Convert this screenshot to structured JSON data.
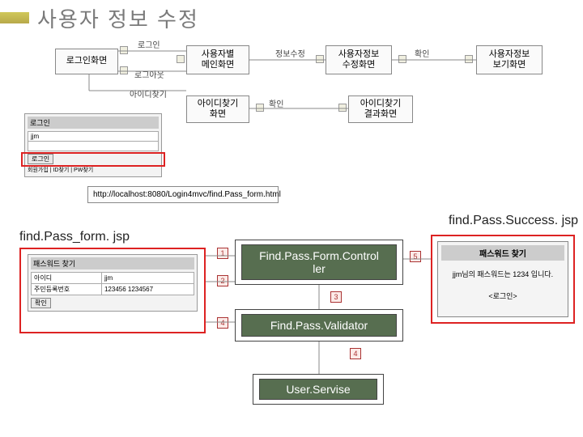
{
  "title": "사용자 정보 수정",
  "flow": {
    "login_screen": "로그인화면",
    "user_main": "사용자별\n메인화면",
    "user_edit": "사용자정보\n수정화면",
    "user_view": "사용자정보\n보기화면",
    "findid_screen": "아이디찾기\n화면",
    "findid_result": "아이디찾기\n결과화면"
  },
  "edges": {
    "login": "로그인",
    "logout": "로그아웃",
    "findid": "아이디찾기",
    "edit_info": "정보수정",
    "confirm1": "확인",
    "confirm2": "확인"
  },
  "url": "http://localhost:8080/Login4mvc/find.Pass_form.html",
  "jsp_form": "find.Pass_form. jsp",
  "jsp_success": "find.Pass.Success. jsp",
  "login_mock": {
    "header": "로그인",
    "id_val": "jjm",
    "btn_login": "로그인",
    "line": "회원가입  |  ID찾기  |  PW찾기"
  },
  "form_mock": {
    "header": "패스워드 찾기",
    "row1_label": "아이디",
    "row1_val": "jjm",
    "row2_label": "주민등록번호",
    "row2_val": "123456 1234567",
    "btn": "확인"
  },
  "controllers": {
    "form_ctrl": "Find.Pass.Form.Control\nler",
    "validator": "Find.Pass.Validator",
    "service": "User.Servise"
  },
  "numbers": {
    "n1": "1",
    "n2": "2",
    "n3": "3",
    "n4a": "4",
    "n4b": "4",
    "n5": "5"
  },
  "success_mock": {
    "header": "패스워드 찾기",
    "msg1": "jjm님의 패스워드는 1234 입니다.",
    "link": "<로그인>"
  }
}
